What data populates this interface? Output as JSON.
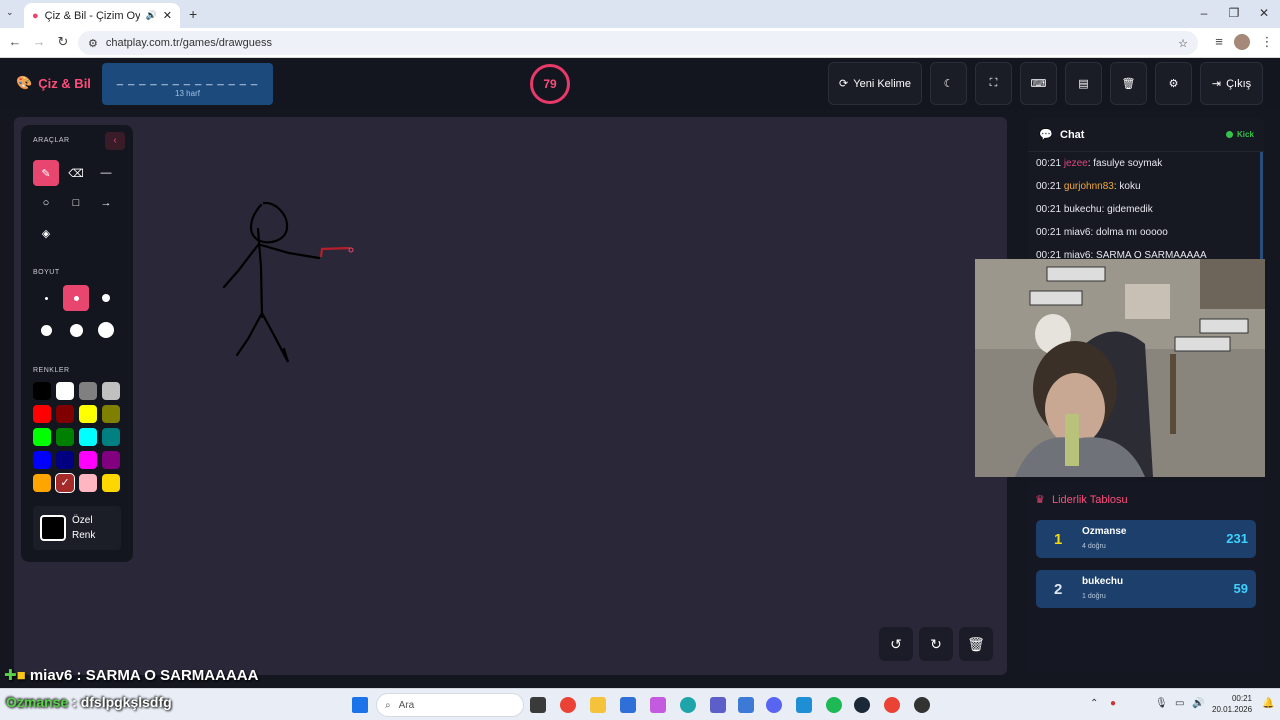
{
  "browser": {
    "tab_title": "Çiz & Bil - Çizim Oyunu",
    "url": "chatplay.com.tr/games/drawguess"
  },
  "header": {
    "brand": "Çiz & Bil",
    "word_mask": "_ _ _ _ _ _ _ _ _ _ _ _ _",
    "letter_count": "13 harf",
    "timer": "79",
    "new_word_label": "Yeni Kelime",
    "logout_label": "Çıkış"
  },
  "tools": {
    "section_tools": "ARAÇLAR",
    "section_size": "BOYUT",
    "section_colors": "RENKLER",
    "custom_color_line1": "Özel",
    "custom_color_line2": "Renk",
    "colors": [
      "#000000",
      "#ffffff",
      "#808080",
      "#c0c0c0",
      "#ff0000",
      "#800000",
      "#ffff00",
      "#808000",
      "#00ff00",
      "#008000",
      "#00ffff",
      "#008080",
      "#0000ff",
      "#000080",
      "#ff00ff",
      "#800080",
      "#ffa500",
      "#a52a2a",
      "#ffb6c1",
      "#ffd700"
    ],
    "accent": "#e8456f"
  },
  "chat": {
    "title": "Chat",
    "status": "Kick",
    "messages": [
      {
        "time": "00:21",
        "user": "jezee",
        "user_color": "#e0457b",
        "text": ": fasulye soymak"
      },
      {
        "time": "00:21",
        "user": "gurjohnn83",
        "user_color": "#f0a93a",
        "text": ": koku"
      },
      {
        "time": "00:21",
        "user": "bukechu",
        "user_color": "#e8e8ee",
        "text": ": gidemedik"
      },
      {
        "time": "00:21",
        "user": "miav6",
        "user_color": "#e8e8ee",
        "text": ": dolma mı ooooo"
      },
      {
        "time": "00:21",
        "user": "miav6",
        "user_color": "#e8e8ee",
        "text": ": SARMA O SARMAAAAA"
      }
    ]
  },
  "leaderboard": {
    "title": "Liderlik Tablosu",
    "rows": [
      {
        "rank": "1",
        "name": "Ozmanse",
        "sub": "4 doğru",
        "score": "231"
      },
      {
        "rank": "2",
        "name": "bukechu",
        "sub": "1 doğru",
        "score": "59"
      }
    ]
  },
  "overlay": {
    "line1_user": "miav6",
    "line1_text": " : SARMA O SARMAAAAA",
    "line2_user": "Ozmanse",
    "line2_text": " : dfslpgkşlsdfg"
  },
  "taskbar": {
    "search_placeholder": "Ara",
    "time": "00:21",
    "date": "20.01.2026"
  }
}
